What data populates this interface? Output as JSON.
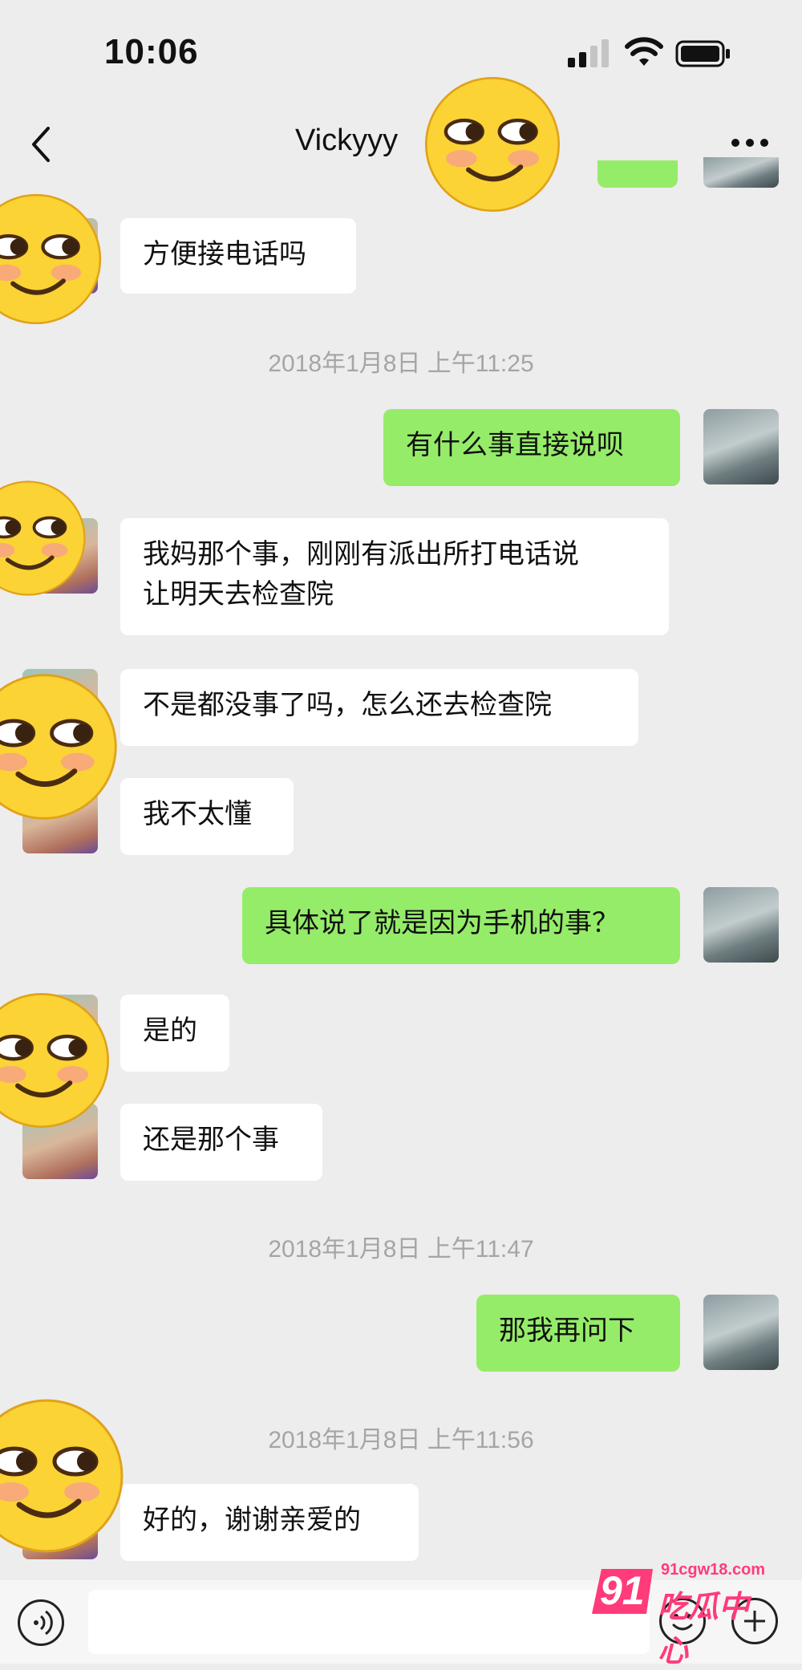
{
  "status": {
    "time": "10:06"
  },
  "header": {
    "back_icon": "chevron-left-icon",
    "title": "Vickyyy",
    "more_icon": "more-icon"
  },
  "messages": [
    {
      "type": "in",
      "text": "方便接电话吗"
    },
    {
      "type": "timestamp",
      "text": "2018年1月8日 上午11:25"
    },
    {
      "type": "out",
      "text": "有什么事直接说呗"
    },
    {
      "type": "in",
      "text": "我妈那个事，刚刚有派出所打电话说\n让明天去检查院"
    },
    {
      "type": "in",
      "text": "不是都没事了吗，怎么还去检查院"
    },
    {
      "type": "in",
      "text": "我不太懂"
    },
    {
      "type": "out",
      "text": "具体说了就是因为手机的事？"
    },
    {
      "type": "in",
      "text": "是的"
    },
    {
      "type": "in",
      "text": "还是那个事"
    },
    {
      "type": "timestamp",
      "text": "2018年1月8日 上午11:47"
    },
    {
      "type": "out",
      "text": "那我再问下"
    },
    {
      "type": "timestamp",
      "text": "2018年1月8日 上午11:56"
    },
    {
      "type": "in",
      "text": "好的，谢谢亲爱的"
    }
  ],
  "input_bar": {
    "voice_icon": "voice-icon",
    "emoji_icon": "emoji-icon",
    "plus_icon": "plus-icon"
  },
  "watermark": {
    "number": "91",
    "site": "91cgw18.com",
    "name": "吃瓜中心"
  },
  "colors": {
    "background": "#ededed",
    "outgoing_bubble": "#95ec69",
    "incoming_bubble": "#ffffff",
    "watermark": "#ff3b7a"
  }
}
